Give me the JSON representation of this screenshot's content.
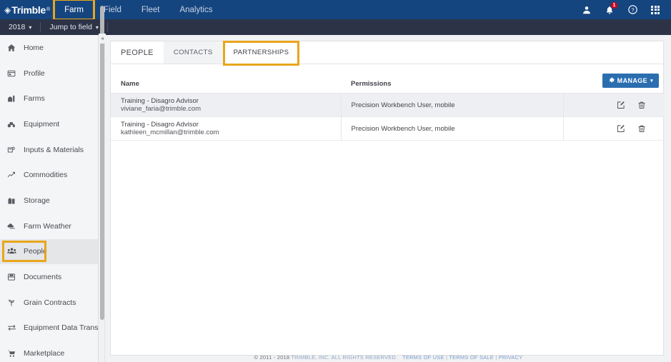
{
  "topnav": {
    "logo": {
      "mark": "◈",
      "text": "Trimble",
      "reg": "®"
    },
    "items": [
      {
        "label": "Farm",
        "active": true
      },
      {
        "label": "Field",
        "active": false
      },
      {
        "label": "Fleet",
        "active": false
      },
      {
        "label": "Analytics",
        "active": false
      }
    ],
    "icons": [
      {
        "name": "user-icon",
        "glyph": "👤"
      },
      {
        "name": "notifications-bell-icon",
        "glyph": "🔔",
        "badge": "1"
      },
      {
        "name": "help-icon",
        "glyph": "?"
      },
      {
        "name": "apps-grid-icon",
        "glyph": "grid"
      }
    ]
  },
  "subnav": {
    "year": "2018",
    "jump_to_field": "Jump to field",
    "caret": "▾"
  },
  "sidebar": {
    "items": [
      {
        "label": "Home",
        "icon": "home-icon",
        "glyph": "⌂",
        "active": false
      },
      {
        "label": "Profile",
        "icon": "profile-icon",
        "glyph": "▤",
        "active": false
      },
      {
        "label": "Farms",
        "icon": "farms-icon",
        "glyph": "Ἶ2",
        "active": false
      },
      {
        "label": "Equipment",
        "icon": "equipment-icon",
        "glyph": "ὩC",
        "active": false
      },
      {
        "label": "Inputs & Materials",
        "icon": "inputs-materials-icon",
        "glyph": "⚙",
        "active": false
      },
      {
        "label": "Commodities",
        "icon": "commodities-icon",
        "glyph": "↗",
        "active": false
      },
      {
        "label": "Storage",
        "icon": "storage-icon",
        "glyph": "ἾD",
        "active": false
      },
      {
        "label": "Farm Weather",
        "icon": "farm-weather-icon",
        "glyph": "☁",
        "active": false
      },
      {
        "label": "People",
        "icon": "people-icon",
        "glyph": "὆5",
        "active": true
      },
      {
        "label": "Documents",
        "icon": "documents-icon",
        "glyph": "὜E",
        "active": false
      },
      {
        "label": "Grain Contracts",
        "icon": "grain-contracts-icon",
        "glyph": "ἳE",
        "active": false
      },
      {
        "label": "Equipment Data Transfer",
        "icon": "equipment-data-transfer-icon",
        "glyph": "⇄",
        "active": false
      },
      {
        "label": "Marketplace",
        "icon": "marketplace-icon",
        "glyph": "Ὥ2",
        "active": false
      }
    ],
    "collapse_arrow": "◄"
  },
  "main": {
    "page_title": "PEOPLE",
    "tabs": [
      {
        "label": "CONTACTS",
        "active": false
      },
      {
        "label": "PARTNERSHIPS",
        "active": true
      }
    ],
    "manage_button": {
      "label": "MANAGE",
      "icon": "gear-icon",
      "caret": "▾"
    },
    "table": {
      "columns": [
        "Name",
        "Permissions"
      ],
      "rows": [
        {
          "name": "Training - Disagro Advisor",
          "email": "viviane_faria@trimble.com",
          "permissions": "Precision Workbench User, mobile",
          "edit_icon": "edit-icon",
          "delete_icon": "trash-icon"
        },
        {
          "name": "Training - Disagro Advisor",
          "email": "kathleen_mcmillan@trimble.com",
          "permissions": "Precision Workbench User, mobile",
          "edit_icon": "edit-icon",
          "delete_icon": "trash-icon"
        }
      ]
    }
  },
  "footer": {
    "copyright": "© 2011 - 2018",
    "company": "TRIMBLE, INC. ALL RIGHTS RESERVED.",
    "links": [
      "TERMS OF USE",
      "TERMS OF SALE",
      "PRIVACY"
    ],
    "separator": "|"
  },
  "colors": {
    "topnav_blue": "#15457f",
    "subnav_dark": "#2c3347",
    "accent_gold": "#e9a61b",
    "button_blue": "#2a6eb0",
    "badge_red": "#d0021b"
  }
}
